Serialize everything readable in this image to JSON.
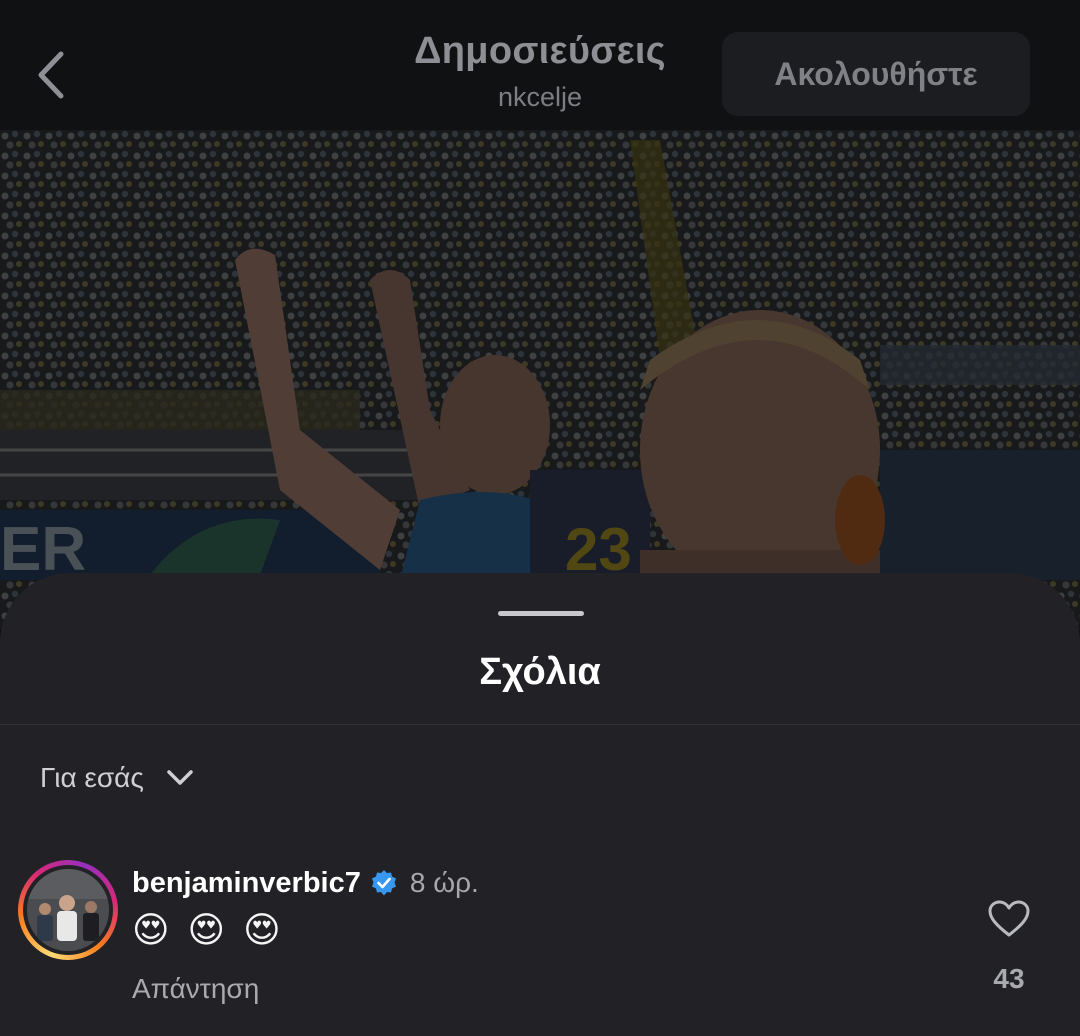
{
  "header": {
    "title": "Δημοσιεύσεις",
    "subtitle": "nkcelje",
    "follow_label": "Ακολουθήστε",
    "back_icon": "chevron-left-icon"
  },
  "post": {
    "image_description_icon": "photo"
  },
  "comments_sheet": {
    "title": "Σχόλια",
    "sort_label": "Για εσάς",
    "sort_icon": "chevron-down-icon",
    "comments": [
      {
        "username": "benjaminverbic7",
        "verified": true,
        "time": "8 ώρ.",
        "text": "😍 😍 😍",
        "reply_label": "Απάντηση",
        "like_count": "43"
      }
    ]
  },
  "colors": {
    "background": "#101113",
    "sheet": "#222226",
    "verified_badge": "#3897f0",
    "muted_text": "#a9aaaf"
  }
}
